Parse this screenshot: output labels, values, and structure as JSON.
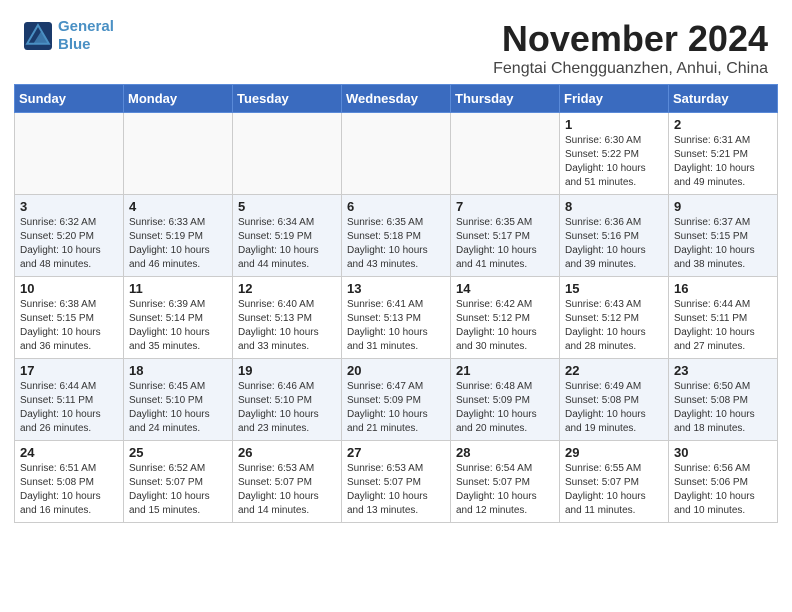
{
  "header": {
    "logo_line1": "General",
    "logo_line2": "Blue",
    "month": "November 2024",
    "location": "Fengtai Chengguanzhen, Anhui, China"
  },
  "weekdays": [
    "Sunday",
    "Monday",
    "Tuesday",
    "Wednesday",
    "Thursday",
    "Friday",
    "Saturday"
  ],
  "rows": [
    [
      {
        "day": "",
        "info": ""
      },
      {
        "day": "",
        "info": ""
      },
      {
        "day": "",
        "info": ""
      },
      {
        "day": "",
        "info": ""
      },
      {
        "day": "",
        "info": ""
      },
      {
        "day": "1",
        "info": "Sunrise: 6:30 AM\nSunset: 5:22 PM\nDaylight: 10 hours\nand 51 minutes."
      },
      {
        "day": "2",
        "info": "Sunrise: 6:31 AM\nSunset: 5:21 PM\nDaylight: 10 hours\nand 49 minutes."
      }
    ],
    [
      {
        "day": "3",
        "info": "Sunrise: 6:32 AM\nSunset: 5:20 PM\nDaylight: 10 hours\nand 48 minutes."
      },
      {
        "day": "4",
        "info": "Sunrise: 6:33 AM\nSunset: 5:19 PM\nDaylight: 10 hours\nand 46 minutes."
      },
      {
        "day": "5",
        "info": "Sunrise: 6:34 AM\nSunset: 5:19 PM\nDaylight: 10 hours\nand 44 minutes."
      },
      {
        "day": "6",
        "info": "Sunrise: 6:35 AM\nSunset: 5:18 PM\nDaylight: 10 hours\nand 43 minutes."
      },
      {
        "day": "7",
        "info": "Sunrise: 6:35 AM\nSunset: 5:17 PM\nDaylight: 10 hours\nand 41 minutes."
      },
      {
        "day": "8",
        "info": "Sunrise: 6:36 AM\nSunset: 5:16 PM\nDaylight: 10 hours\nand 39 minutes."
      },
      {
        "day": "9",
        "info": "Sunrise: 6:37 AM\nSunset: 5:15 PM\nDaylight: 10 hours\nand 38 minutes."
      }
    ],
    [
      {
        "day": "10",
        "info": "Sunrise: 6:38 AM\nSunset: 5:15 PM\nDaylight: 10 hours\nand 36 minutes."
      },
      {
        "day": "11",
        "info": "Sunrise: 6:39 AM\nSunset: 5:14 PM\nDaylight: 10 hours\nand 35 minutes."
      },
      {
        "day": "12",
        "info": "Sunrise: 6:40 AM\nSunset: 5:13 PM\nDaylight: 10 hours\nand 33 minutes."
      },
      {
        "day": "13",
        "info": "Sunrise: 6:41 AM\nSunset: 5:13 PM\nDaylight: 10 hours\nand 31 minutes."
      },
      {
        "day": "14",
        "info": "Sunrise: 6:42 AM\nSunset: 5:12 PM\nDaylight: 10 hours\nand 30 minutes."
      },
      {
        "day": "15",
        "info": "Sunrise: 6:43 AM\nSunset: 5:12 PM\nDaylight: 10 hours\nand 28 minutes."
      },
      {
        "day": "16",
        "info": "Sunrise: 6:44 AM\nSunset: 5:11 PM\nDaylight: 10 hours\nand 27 minutes."
      }
    ],
    [
      {
        "day": "17",
        "info": "Sunrise: 6:44 AM\nSunset: 5:11 PM\nDaylight: 10 hours\nand 26 minutes."
      },
      {
        "day": "18",
        "info": "Sunrise: 6:45 AM\nSunset: 5:10 PM\nDaylight: 10 hours\nand 24 minutes."
      },
      {
        "day": "19",
        "info": "Sunrise: 6:46 AM\nSunset: 5:10 PM\nDaylight: 10 hours\nand 23 minutes."
      },
      {
        "day": "20",
        "info": "Sunrise: 6:47 AM\nSunset: 5:09 PM\nDaylight: 10 hours\nand 21 minutes."
      },
      {
        "day": "21",
        "info": "Sunrise: 6:48 AM\nSunset: 5:09 PM\nDaylight: 10 hours\nand 20 minutes."
      },
      {
        "day": "22",
        "info": "Sunrise: 6:49 AM\nSunset: 5:08 PM\nDaylight: 10 hours\nand 19 minutes."
      },
      {
        "day": "23",
        "info": "Sunrise: 6:50 AM\nSunset: 5:08 PM\nDaylight: 10 hours\nand 18 minutes."
      }
    ],
    [
      {
        "day": "24",
        "info": "Sunrise: 6:51 AM\nSunset: 5:08 PM\nDaylight: 10 hours\nand 16 minutes."
      },
      {
        "day": "25",
        "info": "Sunrise: 6:52 AM\nSunset: 5:07 PM\nDaylight: 10 hours\nand 15 minutes."
      },
      {
        "day": "26",
        "info": "Sunrise: 6:53 AM\nSunset: 5:07 PM\nDaylight: 10 hours\nand 14 minutes."
      },
      {
        "day": "27",
        "info": "Sunrise: 6:53 AM\nSunset: 5:07 PM\nDaylight: 10 hours\nand 13 minutes."
      },
      {
        "day": "28",
        "info": "Sunrise: 6:54 AM\nSunset: 5:07 PM\nDaylight: 10 hours\nand 12 minutes."
      },
      {
        "day": "29",
        "info": "Sunrise: 6:55 AM\nSunset: 5:07 PM\nDaylight: 10 hours\nand 11 minutes."
      },
      {
        "day": "30",
        "info": "Sunrise: 6:56 AM\nSunset: 5:06 PM\nDaylight: 10 hours\nand 10 minutes."
      }
    ]
  ]
}
